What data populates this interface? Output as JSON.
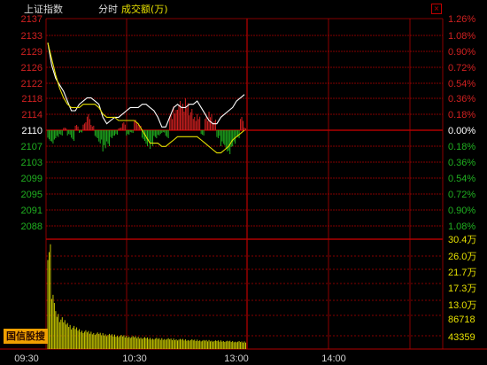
{
  "header": {
    "index_name": "上证指数",
    "mode": "分时",
    "volume_label": "成交额(万)",
    "close_icon": "close-icon"
  },
  "brand": {
    "label": "国信股搜"
  },
  "colors": {
    "background": "#000000",
    "grid": "#b00000",
    "up": "#d02020",
    "down": "#20b020",
    "price_line": "#ffffff",
    "avg_line": "#e6e000",
    "volume_bar": "#c8c800"
  },
  "chart_data": [
    {
      "type": "line",
      "title": "",
      "reference_price": 2110,
      "y_left_ticks": [
        "2137",
        "2133",
        "2129",
        "2126",
        "2122",
        "2118",
        "2114",
        "2110",
        "2107",
        "2103",
        "2099",
        "2095",
        "2091",
        "2088"
      ],
      "y_right_ticks": [
        "1.26%",
        "1.08%",
        "0.90%",
        "0.72%",
        "0.54%",
        "0.36%",
        "0.18%",
        "0.00%",
        "0.18%",
        "0.36%",
        "0.54%",
        "0.72%",
        "0.90%",
        "1.08%"
      ],
      "x_ticks": [
        "09:30",
        "10:30",
        "13:00",
        "14:00"
      ],
      "ylim": [
        2086.7,
        2137
      ],
      "series": [
        {
          "name": "",
          "role": "price",
          "x": [
            0,
            3,
            6,
            9,
            12,
            15,
            18,
            21,
            24,
            27,
            30,
            33,
            36,
            39,
            42,
            45,
            48,
            51,
            54,
            57,
            60,
            63,
            66,
            69,
            72,
            75,
            78,
            81,
            84,
            87,
            90,
            93,
            96,
            99,
            102,
            105,
            108,
            111,
            114,
            117,
            120,
            123,
            126,
            129,
            132,
            135,
            138,
            141,
            144,
            147,
            150
          ],
          "values": [
            2137,
            2130,
            2126,
            2124,
            2122,
            2119,
            2116,
            2116,
            2118,
            2119,
            2120,
            2120,
            2119,
            2118,
            2114,
            2112,
            2113,
            2114,
            2114,
            2115,
            2116,
            2117,
            2117,
            2117,
            2118,
            2118,
            2117,
            2116,
            2114,
            2111,
            2111,
            2114,
            2117,
            2118,
            2117,
            2117,
            2118,
            2118,
            2119,
            2117,
            2115,
            2113,
            2112,
            2112,
            2114,
            2115,
            2116,
            2117,
            2119,
            2120,
            2121
          ]
        },
        {
          "name": "",
          "role": "average",
          "x": [
            0,
            3,
            6,
            9,
            12,
            15,
            18,
            21,
            24,
            27,
            30,
            33,
            36,
            39,
            42,
            45,
            48,
            51,
            54,
            57,
            60,
            63,
            66,
            69,
            72,
            75,
            78,
            81,
            84,
            87,
            90,
            93,
            96,
            99,
            102,
            105,
            108,
            111,
            114,
            117,
            120,
            123,
            126,
            129,
            132,
            135,
            138,
            141,
            144,
            147,
            150
          ],
          "values": [
            2137,
            2132,
            2127,
            2123,
            2120,
            2118,
            2117,
            2117,
            2117,
            2118,
            2118,
            2118,
            2118,
            2117,
            2115,
            2114,
            2114,
            2114,
            2113,
            2113,
            2113,
            2113,
            2113,
            2112,
            2110,
            2108,
            2106,
            2106,
            2106,
            2105,
            2105,
            2106,
            2107,
            2108,
            2108,
            2108,
            2108,
            2108,
            2108,
            2107,
            2106,
            2105,
            2104,
            2103,
            2103,
            2104,
            2105,
            2107,
            2108,
            2109,
            2110
          ]
        }
      ]
    },
    {
      "type": "bar",
      "title": "",
      "role": "breadth",
      "x": [
        0,
        3,
        6,
        9,
        12,
        15,
        18,
        21,
        24,
        27,
        30,
        33,
        36,
        39,
        42,
        45,
        48,
        51,
        54,
        57,
        60,
        63,
        66,
        69,
        72,
        75,
        78,
        81,
        84,
        87,
        90,
        93,
        96,
        99,
        102,
        105,
        108,
        111,
        114,
        117,
        120,
        123,
        126,
        129,
        132,
        135,
        138,
        141,
        144,
        147,
        150
      ],
      "values": [
        -4,
        -5,
        -3,
        -2,
        1,
        -2,
        -4,
        2,
        -1,
        3,
        6,
        2,
        -3,
        -5,
        -8,
        -6,
        -3,
        -2,
        1,
        3,
        -2,
        -1,
        4,
        2,
        -4,
        -6,
        -7,
        -3,
        -2,
        -1,
        -3,
        6,
        9,
        11,
        10,
        12,
        8,
        5,
        6,
        -2,
        5,
        7,
        4,
        -3,
        -6,
        -8,
        -9,
        -6,
        -3,
        5,
        1
      ]
    },
    {
      "type": "bar",
      "title": "",
      "role": "volume",
      "ylabel": "成交额(万)",
      "y_ticks": [
        "30.4万",
        "26.0万",
        "21.7万",
        "17.3万",
        "13.0万",
        "86718",
        "43359"
      ],
      "ylim": [
        0,
        304000
      ],
      "x": [
        0,
        3,
        6,
        9,
        12,
        15,
        18,
        21,
        24,
        27,
        30,
        33,
        36,
        39,
        42,
        45,
        48,
        51,
        54,
        57,
        60,
        63,
        66,
        69,
        72,
        75,
        78,
        81,
        84,
        87,
        90,
        93,
        96,
        99,
        102,
        105,
        108,
        111,
        114,
        117,
        120,
        123,
        126,
        129,
        132,
        135,
        138,
        141,
        144,
        147,
        150
      ],
      "values": [
        290000,
        150000,
        105000,
        88000,
        80000,
        72000,
        64000,
        60000,
        55000,
        52000,
        50000,
        48000,
        46000,
        45000,
        44000,
        42000,
        41000,
        40000,
        39000,
        38000,
        37000,
        36000,
        35000,
        34000,
        33000,
        32000,
        31000,
        31000,
        30000,
        30000,
        30000,
        29000,
        29000,
        28000,
        28000,
        27000,
        27000,
        26000,
        26000,
        25000,
        25000,
        25000,
        24000,
        24000,
        24000,
        23000,
        23000,
        22000,
        22000,
        21000,
        21000
      ]
    }
  ]
}
